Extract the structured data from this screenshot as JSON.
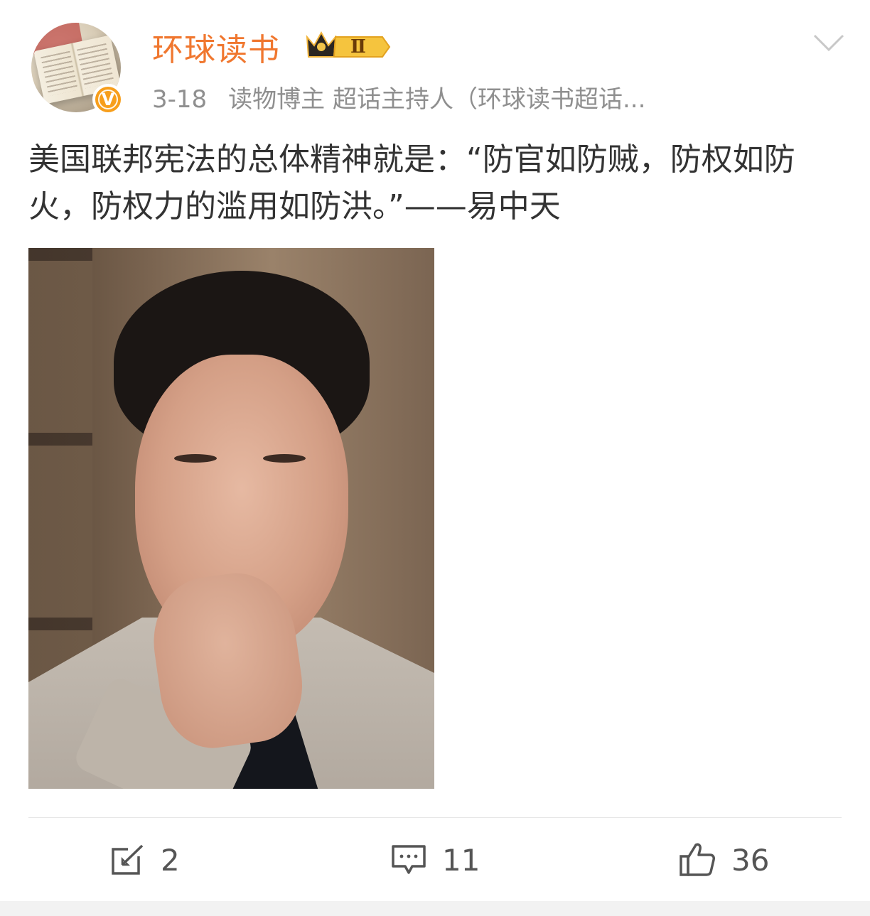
{
  "post": {
    "username": "环球读书",
    "vip_level": "Ⅱ",
    "time": "3-18",
    "description": "读物博主 超话主持人（环球读书超话...",
    "verified_mark": "V",
    "content": "美国联邦宪法的总体精神就是：“防官如防贼，防权如防火，防权力的滥用如防洪。”——易中天",
    "icons": {
      "menu": "chevron-down-icon",
      "repost": "repost-icon",
      "comment": "comment-icon",
      "like": "thumbs-up-icon",
      "vip": "crown-icon"
    },
    "colors": {
      "username": "#f0772f",
      "verified": "#f79e1b",
      "meta": "#8f8f8f"
    }
  },
  "actions": {
    "repost_count": "2",
    "comment_count": "11",
    "like_count": "36"
  }
}
